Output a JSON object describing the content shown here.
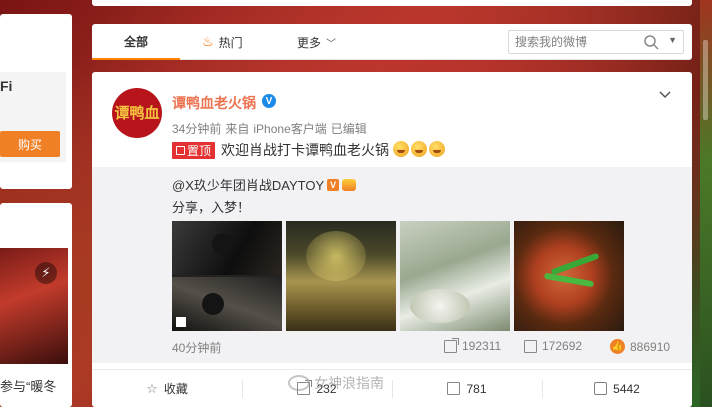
{
  "left": {
    "card1_text": "Fi",
    "buy_label": "购买",
    "caption": "参与“暖冬"
  },
  "tabs": {
    "all": "全部",
    "hot": "热门",
    "more": "更多"
  },
  "search": {
    "placeholder": "搜索我的微博"
  },
  "post": {
    "username": "谭鸭血老火锅",
    "avatar_text": "谭鸭血",
    "time": "34分钟前",
    "from_label": "来自",
    "source": "iPhone客户端",
    "edited": "已编辑",
    "pin_label": "置顶",
    "text": "欢迎肖战打卡谭鸭血老火锅",
    "emoji_count": 3
  },
  "repost": {
    "author": "@X玖少年团肖战DAYTOY",
    "author_badge": "V",
    "text": "分享，入梦！",
    "time": "40分钟前",
    "shares": "192311",
    "comments": "172692",
    "likes": "886910"
  },
  "actions": {
    "collect": "收藏",
    "share": "232",
    "comment": "781",
    "like": "5442"
  },
  "watermark": "女神浪指南"
}
